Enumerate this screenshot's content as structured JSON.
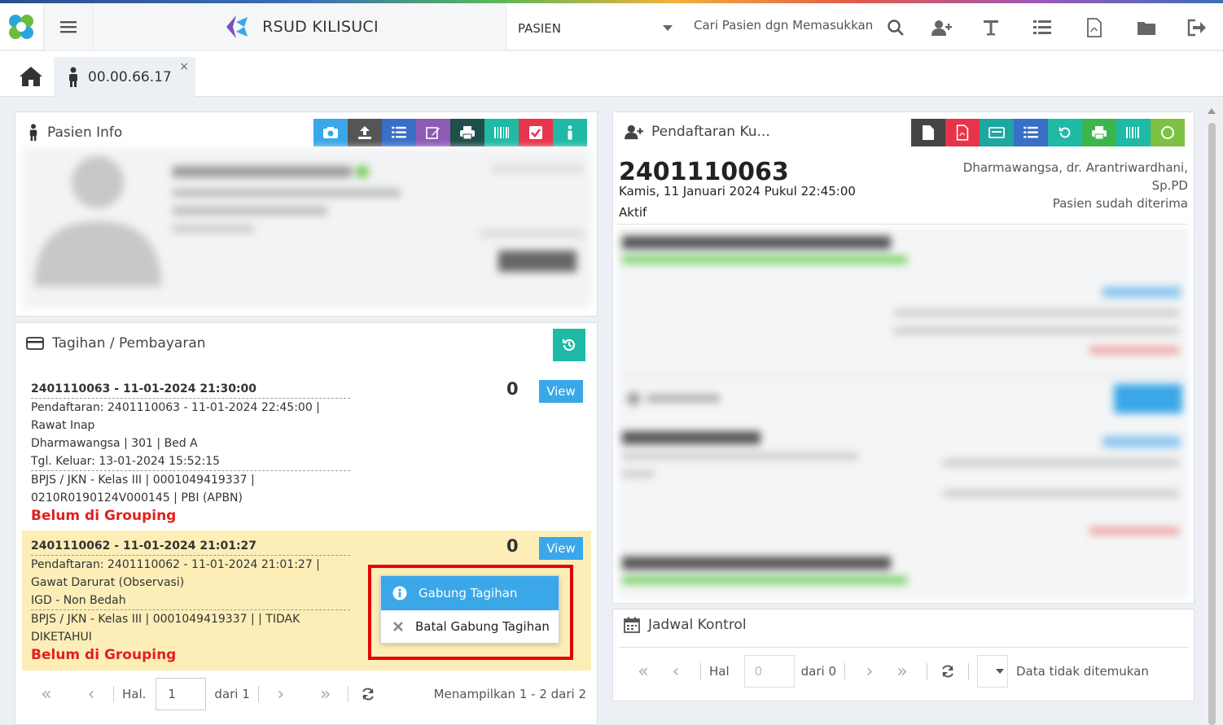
{
  "header": {
    "hospital_name": "RSUD KILISUCI",
    "search_type": "PASIEN",
    "search_placeholder": "Cari Pasien dgn Memasukkan"
  },
  "tabs": {
    "patient_tab_label": "00.00.66.17",
    "close_symbol": "×"
  },
  "patient_info": {
    "title": "Pasien Info"
  },
  "billing": {
    "title": "Tagihan / Pembayaran",
    "view_label": "View",
    "items": [
      {
        "header": "2401110063 - 11-01-2024 21:30:00",
        "count": "0",
        "line1": "Pendaftaran: 2401110063 - 11-01-2024 22:45:00 |",
        "line2": "Rawat Inap",
        "line3": "Dharmawangsa | 301 | Bed A",
        "line4": "Tgl. Keluar: 13-01-2024 15:52:15",
        "line5": "BPJS / JKN - Kelas III | 0001049419337 |",
        "line6": "0210R0190124V000145 | PBI (APBN)",
        "status": "Belum di Grouping"
      },
      {
        "header": "2401110062 - 11-01-2024 21:01:27",
        "count": "0",
        "line1": "Pendaftaran: 2401110062 - 11-01-2024 21:01:27 |",
        "line2": "Gawat Darurat (Observasi)",
        "line3": "IGD - Non Bedah",
        "line4": "BPJS / JKN - Kelas III | 0001049419337 | | TIDAK",
        "line5": "DIKETAHUI",
        "status": "Belum di Grouping"
      }
    ],
    "context_menu": {
      "merge_label": "Gabung Tagihan",
      "cancel_label": "Batal Gabung Tagihan"
    },
    "pager": {
      "page_label": "Hal.",
      "page_value": "1",
      "of_label": "dari 1",
      "summary": "Menampilkan 1 - 2 dari 2"
    }
  },
  "registration": {
    "title": "Pendaftaran Ku...",
    "number": "2401110063",
    "datetime": "Kamis, 11 Januari 2024 Pukul 22:45:00",
    "status": "Aktif",
    "room_doctor": "Dharmawangsa, dr. Arantriwardhani,",
    "specialty": "Sp.PD",
    "accepted": "Pasien sudah diterima"
  },
  "schedule": {
    "title": "Jadwal Kontrol",
    "page_label": "Hal",
    "page_placeholder": "0",
    "of_label": "dari 0",
    "empty_msg": "Data tidak ditemukan"
  },
  "colors": {
    "accent_blue": "#3aa7e8",
    "danger_red": "#e02020",
    "highlight_row": "#fdeeb8",
    "teal": "#1ebaa5"
  }
}
